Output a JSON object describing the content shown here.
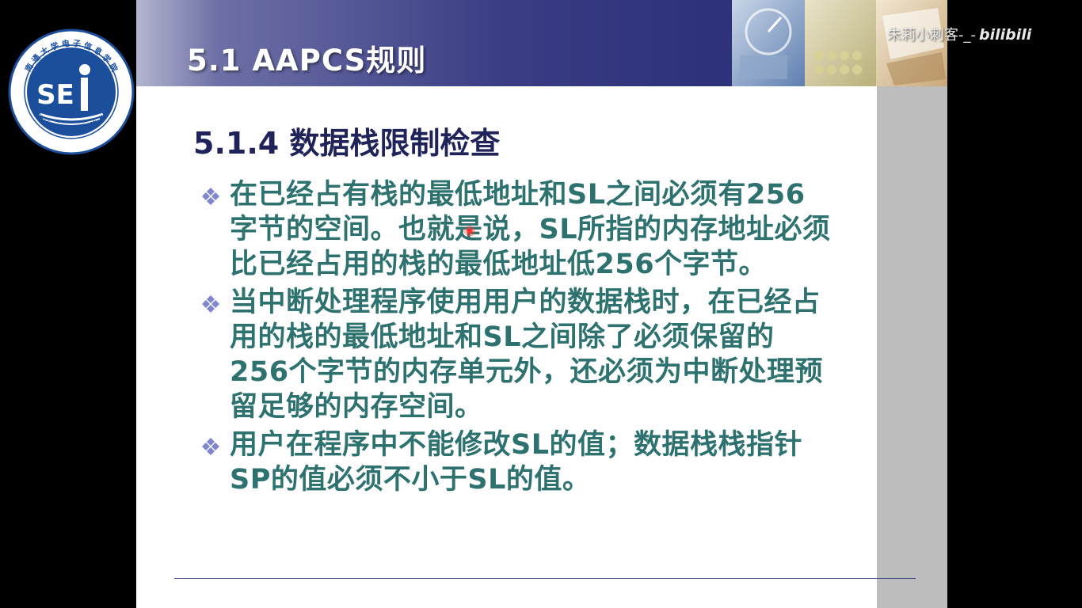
{
  "header": {
    "title": "5.1  AAPCS规则"
  },
  "logo": {
    "name": "school-logo",
    "icon": "sei-emblem",
    "text": "南通大学电子信息学院 SCHOOL OF ELECTRONICS AND INFORMATION · NANTONG UNIVERSITY"
  },
  "section": {
    "title": "5.1.4 数据栈限制检查"
  },
  "bullets": [
    {
      "text": "在已经占有栈的最低地址和SL之间必须有256字节的空间。也就是说，SL所指的内存地址必须比已经占用的栈的最低地址低256个字节。"
    },
    {
      "text": "当中断处理程序使用用户的数据栈时，在已经占用的栈的最低地址和SL之间除了必须保留的256个字节的内存单元外，还必须为中断处理预留足够的内存空间。"
    },
    {
      "text": "用户在程序中不能修改SL的值；数据栈栈指针SP的值必须不小于SL的值。"
    }
  ],
  "watermark": {
    "user": "朱莉小刺客-_-",
    "brand": "bilibili"
  },
  "colors": {
    "header_dark": "#2e327a",
    "body_text": "#2e7270",
    "title_text": "#1f2359",
    "bullet_icon": "#7f86c9"
  }
}
